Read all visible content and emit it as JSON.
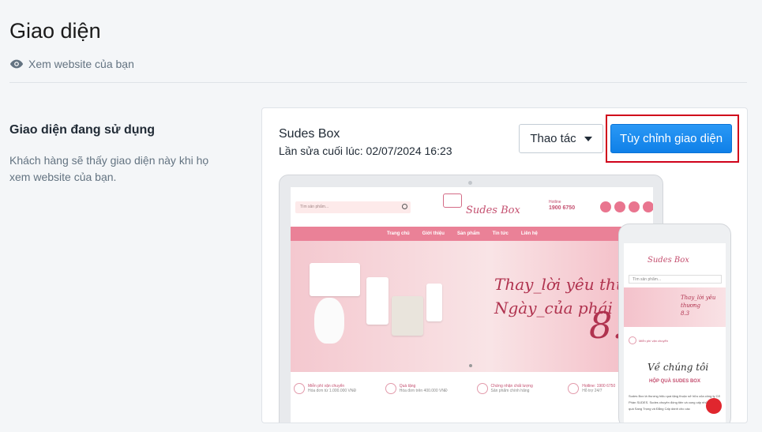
{
  "page": {
    "title": "Giao diện",
    "view_link": "Xem website của bạn"
  },
  "section": {
    "title": "Giao diện đang sử dụng",
    "description": "Khách hàng sẽ thấy giao diện này khi họ xem website của bạn."
  },
  "theme": {
    "name": "Sudes Box",
    "last_edited": "Lần sửa cuối lúc: 02/07/2024 16:23",
    "actions_label": "Thao tác",
    "customize_label": "Tùy chỉnh giao diện"
  },
  "preview": {
    "search_placeholder": "Tìm sản phẩm...",
    "logo": "Sudes Box",
    "hotline_label": "Hotline",
    "hotline_number": "1900 6750",
    "nav": [
      "Trang chủ",
      "Giới thiệu",
      "Sản phẩm",
      "Tin tức",
      "Liên hệ"
    ],
    "banner_line1": "Thay_lời yêu thương",
    "banner_line2": "Ngày_của phái nữ",
    "banner_number": "8.3",
    "features": [
      {
        "title": "Miễn phí vận chuyển",
        "sub": "Hóa đơn từ 1.000.000 VNĐ"
      },
      {
        "title": "Quà tặng",
        "sub": "Hóa đơn trên 400.000 VNĐ"
      },
      {
        "title": "Chứng nhận chất lượng",
        "sub": "Sản phẩm chính hãng"
      },
      {
        "title": "Hotline: 1900 6750",
        "sub": "Hỗ trợ 24/7"
      }
    ],
    "about_title": "Về chúng tôi",
    "mobile_heading": "HỘP QUÀ SUDES BOX",
    "mobile_text": "Sudes Box là thương hiệu quà tặng thuộc sở hữu của công ty Cổ Phần SUDES. Sudes chuyên đóng tiện và cung cấp những món quà Sang Trọng và Đẳng Cấp dành cho các"
  },
  "colors": {
    "primary_button": "#1a8cf2",
    "highlight_border": "#d0021b",
    "preview_pink": "#ea8197"
  }
}
